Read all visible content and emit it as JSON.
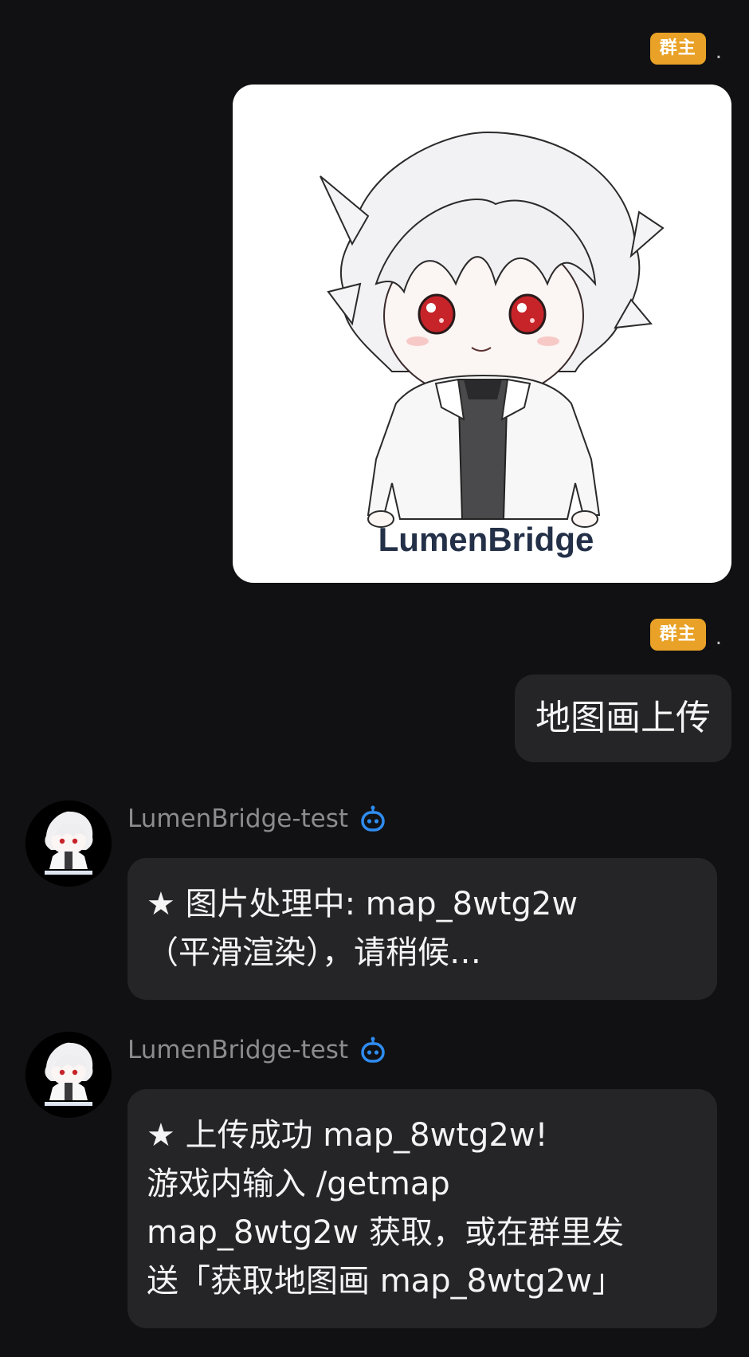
{
  "messages": [
    {
      "id": "m1",
      "direction": "out",
      "badge": "群主",
      "sender_suffix": ".",
      "image": {
        "caption_text": "LumenBridge",
        "icon": "chibi-character-logo"
      }
    },
    {
      "id": "m2",
      "direction": "out",
      "badge": "群主",
      "sender_suffix": ".",
      "text": "地图画上传"
    },
    {
      "id": "m3",
      "direction": "in",
      "sender": "LumenBridge-test",
      "sender_icon": "bot-icon",
      "lines": [
        "★ 图片处理中: map_8wtg2w",
        "（平滑渲染），请稍候…"
      ]
    },
    {
      "id": "m4",
      "direction": "in",
      "sender": "LumenBridge-test",
      "sender_icon": "bot-icon",
      "lines": [
        "★ 上传成功 map_8wtg2w!",
        "游戏内输入 /getmap",
        "map_8wtg2w 获取，或在群里发",
        "送「获取地图画 map_8wtg2w」"
      ]
    }
  ],
  "colors": {
    "background": "#111113",
    "bubble": "#252528",
    "badge": "#e9a227",
    "bot_icon": "#2f8cf0",
    "sender_name": "#8c8c8f"
  }
}
